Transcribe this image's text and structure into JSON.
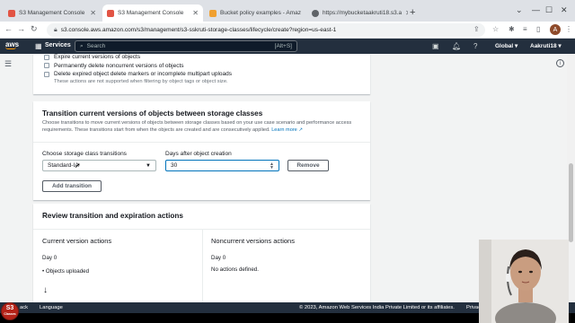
{
  "browser": {
    "tabs": [
      {
        "title": "S3 Management Console",
        "fav_color": "#e25444",
        "active": false
      },
      {
        "title": "S3 Management Console",
        "fav_color": "#e25444",
        "active": true
      },
      {
        "title": "Bucket policy examples - Amaz",
        "fav_color": "#f0a030",
        "active": false
      },
      {
        "title": "https://mybucketaakruti18.s3.a",
        "fav_color": "#5f6368",
        "active": false
      }
    ],
    "new_tab_icon": "plus-icon",
    "url": "s3.console.aws.amazon.com/s3/management/s3-sskruti-storage-classes/lifecycle/create?region=us-east-1",
    "profile_initial": "A"
  },
  "aws_header": {
    "logo": "aws",
    "services_label": "Services",
    "search_placeholder": "Search",
    "search_shortcut": "[Alt+S]",
    "region": "Global",
    "account": "Aakruti18"
  },
  "expiration_actions": {
    "checkboxes": [
      {
        "label": "Expire current versions of objects",
        "checked": false
      },
      {
        "label": "Permanently delete noncurrent versions of objects",
        "checked": false
      },
      {
        "label": "Delete expired object delete markers or incomplete multipart uploads",
        "checked": false
      }
    ],
    "hint": "These actions are not supported when filtering by object tags or object size."
  },
  "transitions": {
    "title": "Transition current versions of objects between storage classes",
    "description": "Choose transitions to move current versions of objects between storage classes based on your use case scenario and performance access requirements. These transitions start from when the objects are created and are consecutively applied.",
    "learn_more": "Learn more",
    "storage_class_label": "Choose storage class transitions",
    "storage_class_value": "Standard-IA",
    "days_label": "Days after object creation",
    "days_value": "30",
    "remove_button": "Remove",
    "add_button": "Add transition"
  },
  "review": {
    "title": "Review transition and expiration actions",
    "current": {
      "heading": "Current version actions",
      "day": "Day 0",
      "item": "Objects uploaded"
    },
    "noncurrent": {
      "heading": "Noncurrent versions actions",
      "day": "Day 0",
      "item": "No actions defined."
    }
  },
  "footer": {
    "feedback": "ack",
    "language": "Language",
    "copyright": "© 2023, Amazon Web Services India Private Limited or its affiliates.",
    "privacy": "Privacy"
  },
  "overlay_badge": {
    "top": "S3",
    "bottom": "Classes"
  }
}
